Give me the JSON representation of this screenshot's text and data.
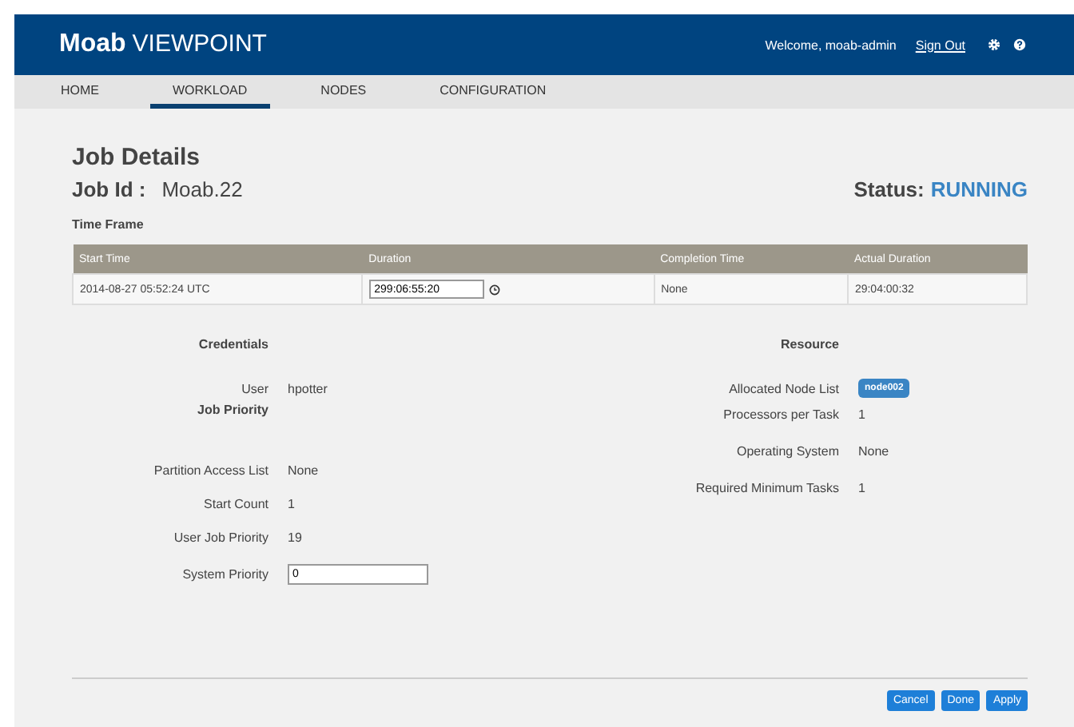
{
  "header": {
    "logo_bold": "Moab",
    "logo_light": "VIEWPOINT",
    "welcome": "Welcome, moab-admin",
    "sign_out": "Sign Out"
  },
  "tabs": [
    {
      "label": "HOME",
      "selected": false
    },
    {
      "label": "WORKLOAD",
      "selected": true
    },
    {
      "label": "NODES",
      "selected": false
    },
    {
      "label": "CONFIGURATION",
      "selected": false
    }
  ],
  "page_title": "Job Details",
  "job_id_label": "Job Id :",
  "job_id": "Moab.22",
  "status_label": "Status:",
  "status": "RUNNING",
  "time_frame": {
    "title": "Time Frame",
    "columns": [
      "Start Time",
      "Duration",
      "Completion Time",
      "Actual Duration"
    ],
    "row": {
      "start_time": "2014-08-27 05:52:24 UTC",
      "duration": "299:06:55:20",
      "completion_time": "None",
      "actual_duration": "29:04:00:32"
    }
  },
  "credentials": {
    "title": "Credentials",
    "fields": [
      {
        "label": "User",
        "value": "hpotter"
      }
    ]
  },
  "job_priority": {
    "title": "Job Priority",
    "fields": [
      {
        "kind": "text",
        "label": "Partition Access List",
        "value": "None"
      },
      {
        "kind": "text",
        "label": "Start Count",
        "value": "1"
      },
      {
        "kind": "text",
        "label": "User Job Priority",
        "value": "19"
      },
      {
        "kind": "input",
        "label": "System Priority",
        "value": "0"
      }
    ]
  },
  "resource": {
    "title": "Resource",
    "fields": [
      {
        "kind": "tag",
        "label": "Allocated Node List",
        "value": "node002"
      },
      {
        "kind": "text",
        "label": "Processors per Task",
        "value": "1"
      },
      {
        "kind": "text",
        "label": "Operating System",
        "value": "None"
      },
      {
        "kind": "text",
        "label": "Required Minimum Tasks",
        "value": "1"
      }
    ]
  },
  "buttons": [
    "Cancel",
    "Done",
    "Apply"
  ]
}
